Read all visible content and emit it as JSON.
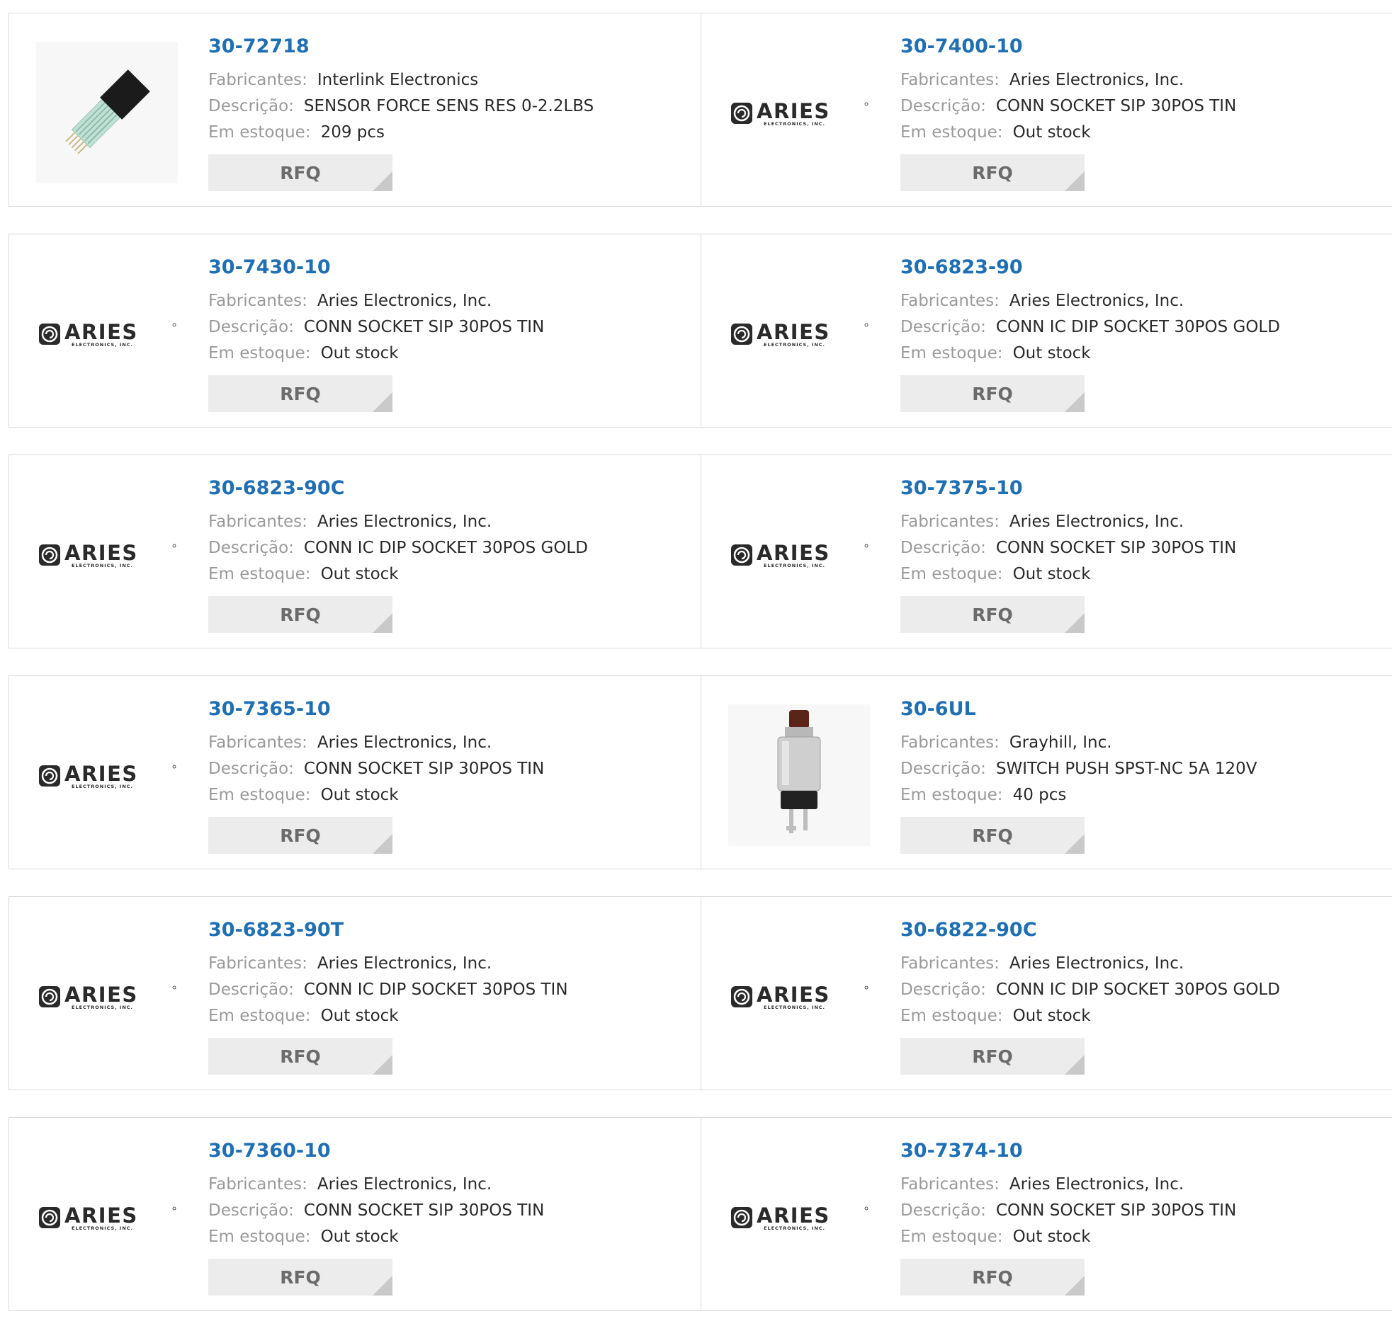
{
  "labels": {
    "manufacturer": "Fabricantes:",
    "description": "Descrição:",
    "stock": "Em estoque:",
    "rfq": "RFQ"
  },
  "logo": {
    "aries_text": "ARIES",
    "aries_sub": "ELECTRONICS, INC."
  },
  "colors": {
    "part_link": "#1f6fb5",
    "label_gray": "#9a9a9a",
    "rfq_bg": "#ececec"
  },
  "products": [
    {
      "part": "30-72718",
      "manufacturer": "Interlink Electronics",
      "description": "SENSOR FORCE SENS RES 0-2.2LBS",
      "stock": "209 pcs",
      "image": "force-sensor-photo"
    },
    {
      "part": "30-7400-10",
      "manufacturer": "Aries Electronics, Inc.",
      "description": "CONN SOCKET SIP 30POS TIN",
      "stock": "Out stock",
      "image": "aries-logo"
    },
    {
      "part": "30-7430-10",
      "manufacturer": "Aries Electronics, Inc.",
      "description": "CONN SOCKET SIP 30POS TIN",
      "stock": "Out stock",
      "image": "aries-logo"
    },
    {
      "part": "30-6823-90",
      "manufacturer": "Aries Electronics, Inc.",
      "description": "CONN IC DIP SOCKET 30POS GOLD",
      "stock": "Out stock",
      "image": "aries-logo"
    },
    {
      "part": "30-6823-90C",
      "manufacturer": "Aries Electronics, Inc.",
      "description": "CONN IC DIP SOCKET 30POS GOLD",
      "stock": "Out stock",
      "image": "aries-logo"
    },
    {
      "part": "30-7375-10",
      "manufacturer": "Aries Electronics, Inc.",
      "description": "CONN SOCKET SIP 30POS TIN",
      "stock": "Out stock",
      "image": "aries-logo"
    },
    {
      "part": "30-7365-10",
      "manufacturer": "Aries Electronics, Inc.",
      "description": "CONN SOCKET SIP 30POS TIN",
      "stock": "Out stock",
      "image": "aries-logo"
    },
    {
      "part": "30-6UL",
      "manufacturer": "Grayhill, Inc.",
      "description": "SWITCH PUSH SPST-NC 5A 120V",
      "stock": "40 pcs",
      "image": "push-switch-photo"
    },
    {
      "part": "30-6823-90T",
      "manufacturer": "Aries Electronics, Inc.",
      "description": "CONN IC DIP SOCKET 30POS TIN",
      "stock": "Out stock",
      "image": "aries-logo"
    },
    {
      "part": "30-6822-90C",
      "manufacturer": "Aries Electronics, Inc.",
      "description": "CONN IC DIP SOCKET 30POS GOLD",
      "stock": "Out stock",
      "image": "aries-logo"
    },
    {
      "part": "30-7360-10",
      "manufacturer": "Aries Electronics, Inc.",
      "description": "CONN SOCKET SIP 30POS TIN",
      "stock": "Out stock",
      "image": "aries-logo"
    },
    {
      "part": "30-7374-10",
      "manufacturer": "Aries Electronics, Inc.",
      "description": "CONN SOCKET SIP 30POS TIN",
      "stock": "Out stock",
      "image": "aries-logo"
    }
  ]
}
